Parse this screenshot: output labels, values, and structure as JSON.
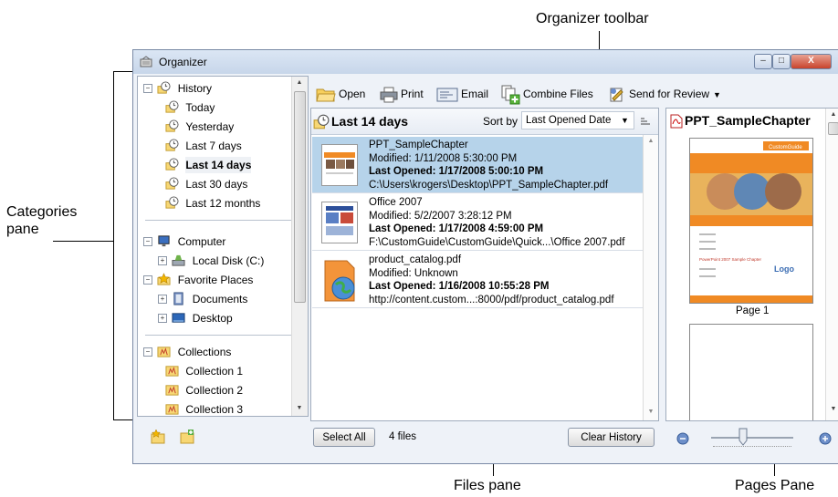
{
  "callouts": {
    "organizer_toolbar": "Organizer toolbar",
    "categories_pane": "Categories\npane",
    "files_pane": "Files pane",
    "pages_pane": "Pages Pane"
  },
  "window": {
    "title": "Organizer",
    "minimize": "–",
    "maximize": "□",
    "close": "X"
  },
  "categories": {
    "history": {
      "label": "History",
      "items": [
        "Today",
        "Yesterday",
        "Last 7 days",
        "Last 14 days",
        "Last 30 days",
        "Last 12 months"
      ],
      "selected": "Last 14 days"
    },
    "computer": {
      "label": "Computer",
      "items": [
        "Local Disk (C:)"
      ]
    },
    "favorites": {
      "label": "Favorite Places",
      "items": [
        "Documents",
        "Desktop"
      ]
    },
    "collections": {
      "label": "Collections",
      "items": [
        "Collection 1",
        "Collection 2",
        "Collection 3"
      ]
    }
  },
  "toolbar": {
    "open": "Open",
    "print": "Print",
    "email": "Email",
    "combine": "Combine Files",
    "review": "Send for Review"
  },
  "files_pane": {
    "heading": "Last 14 days",
    "sort_label": "Sort by",
    "sort_value": "Last Opened Date",
    "files": [
      {
        "name": "PPT_SampleChapter",
        "modified": "Modified: 1/11/2008 5:30:00 PM",
        "opened": "Last Opened: 1/17/2008 5:00:10 PM",
        "path": "C:\\Users\\krogers\\Desktop\\PPT_SampleChapter.pdf"
      },
      {
        "name": "Office 2007",
        "modified": "Modified: 5/2/2007 3:28:12 PM",
        "opened": "Last Opened: 1/17/2008 4:59:00 PM",
        "path": "F:\\CustomGuide\\CustomGuide\\Quick...\\Office 2007.pdf"
      },
      {
        "name": "product_catalog.pdf",
        "modified": "Modified: Unknown",
        "opened": "Last Opened: 1/16/2008 10:55:28 PM",
        "path": "http://content.custom...:8000/pdf/product_catalog.pdf"
      }
    ],
    "select_all": "Select All",
    "file_count": "4 files",
    "clear_history": "Clear History"
  },
  "pages_pane": {
    "title": "PPT_SampleChapter",
    "page1_label": "Page 1",
    "thumb_logo": "CustomGuide",
    "thumb_mini_title": "PowerPoint 2007 Sample Chapter",
    "thumb_logo2": "Logo"
  }
}
